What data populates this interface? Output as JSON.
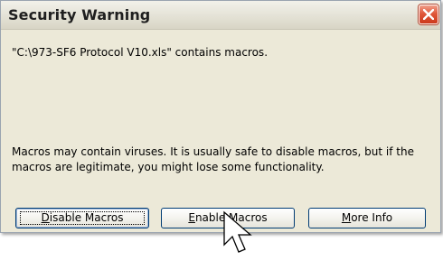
{
  "dialog": {
    "title": "Security Warning",
    "file_message": "\"C:\\973-SF6 Protocol V10.xls\" contains macros.",
    "warning_line1": "Macros may contain viruses. It is usually safe to disable macros, but if the",
    "warning_line2": "macros are legitimate, you might lose some functionality.",
    "buttons": {
      "disable": {
        "underlined": "D",
        "rest": "isable Macros"
      },
      "enable": {
        "underlined": "E",
        "rest": "nable Macros"
      },
      "more": {
        "prefix": "",
        "underlined": "M",
        "rest": "ore Info"
      }
    },
    "close_icon": "close-x-icon",
    "cursor_icon": "arrow-pointer-icon"
  },
  "colors": {
    "dialog_bg": "#ece9d8",
    "close_button": "#e0573a",
    "button_border": "#003c74"
  }
}
